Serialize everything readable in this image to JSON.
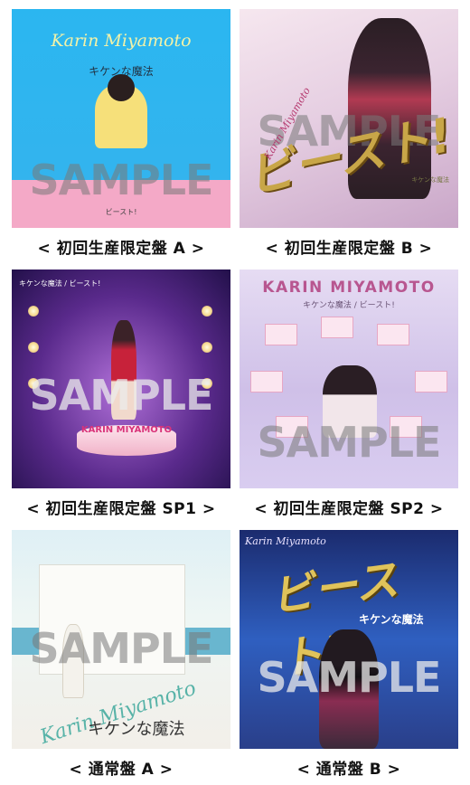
{
  "watermark": "SAMPLE",
  "items": [
    {
      "caption": "< 初回生産限定盤 A >",
      "cover_text": [
        "Karin Miyamoto",
        "キケンな魔法",
        "ビースト!"
      ]
    },
    {
      "caption": "< 初回生産限定盤 B >",
      "cover_text": [
        "ビースト!",
        "Karin Miyamoto",
        "キケンな魔法"
      ]
    },
    {
      "caption": "< 初回生産限定盤 SP1 >",
      "cover_text": [
        "キケンな魔法 / ビースト!",
        "KARIN MIYAMOTO"
      ]
    },
    {
      "caption": "< 初回生産限定盤 SP2 >",
      "cover_text": [
        "KARIN MIYAMOTO",
        "キケンな魔法 / ビースト!"
      ]
    },
    {
      "caption": "< 通常盤 A >",
      "cover_text": [
        "Karin Miyamoto",
        "キケンな魔法"
      ]
    },
    {
      "caption": "< 通常盤 B >",
      "cover_text": [
        "ビースト!",
        "Karin Miyamoto",
        "キケンな魔法"
      ]
    }
  ]
}
